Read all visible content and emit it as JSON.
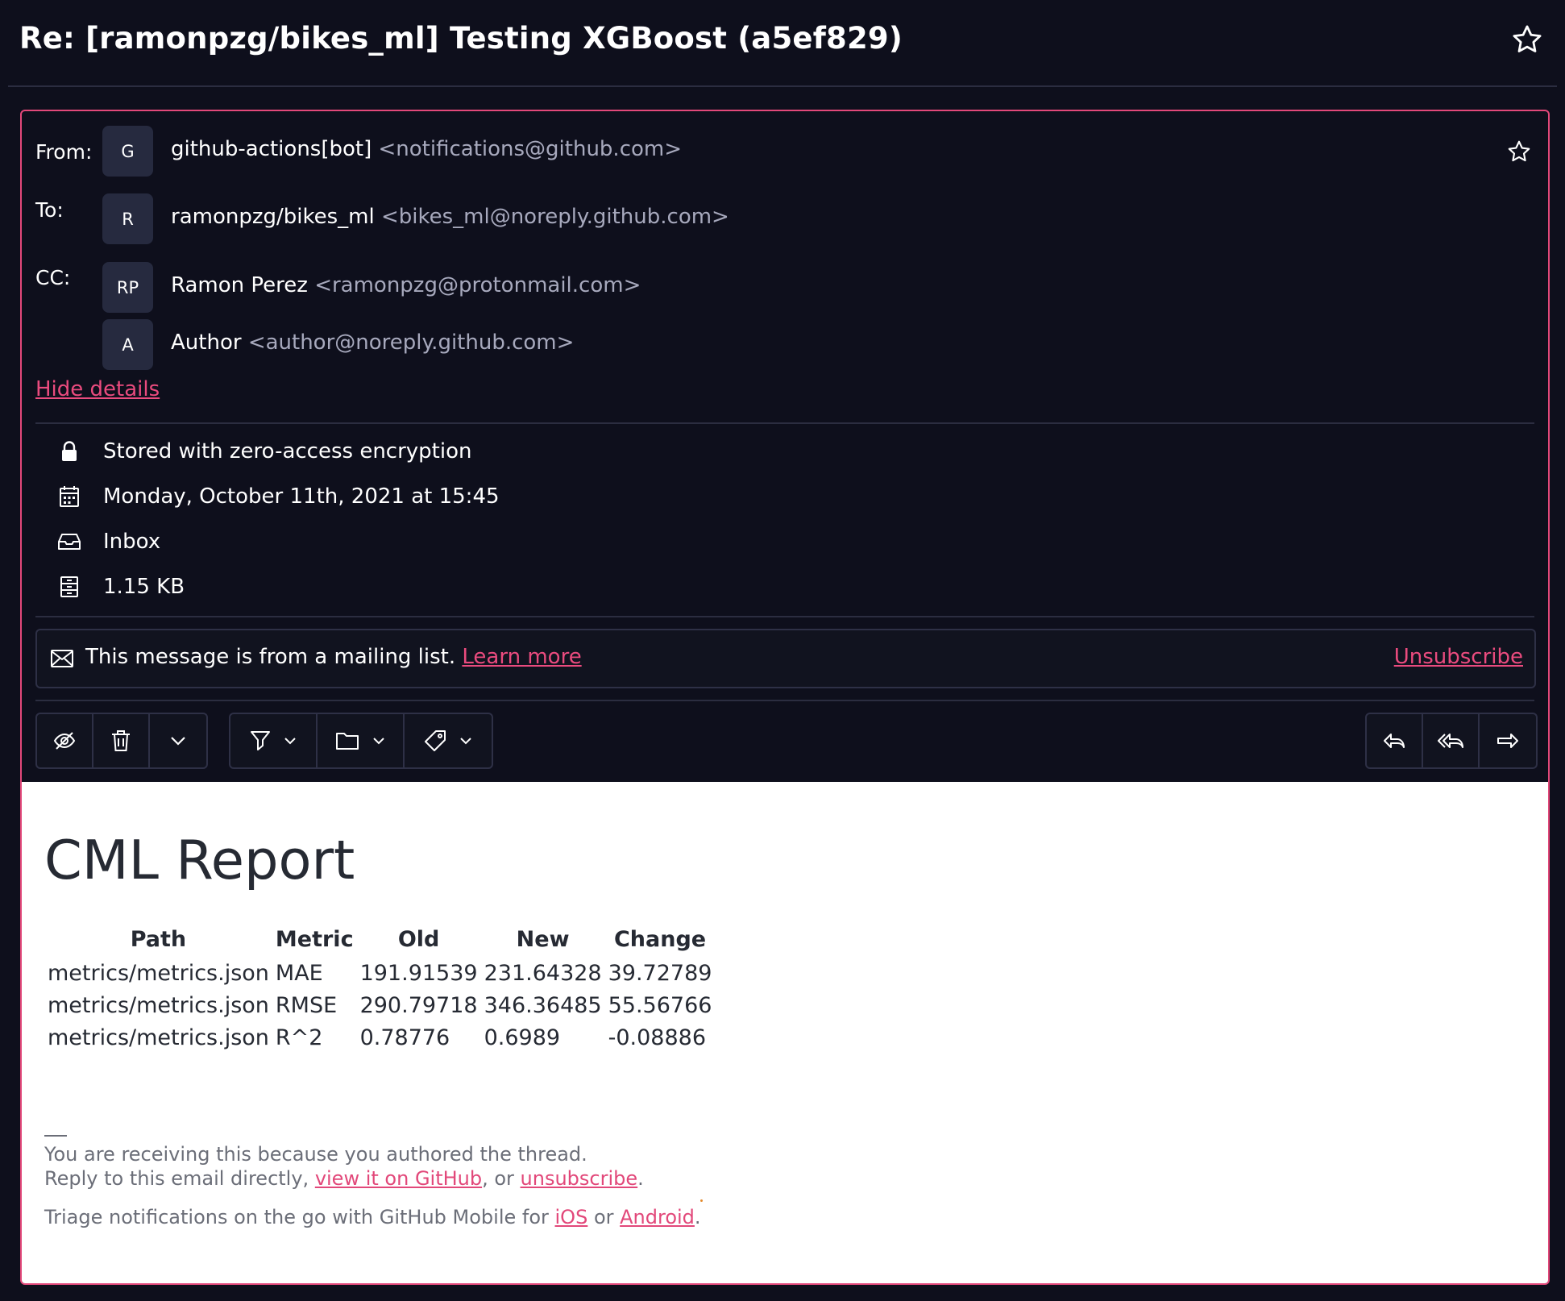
{
  "subject": "Re: [ramonpzg/bikes_ml] Testing XGBoost (a5ef829)",
  "header": {
    "from_label": "From:",
    "to_label": "To:",
    "cc_label": "CC:",
    "from": {
      "initials": "G",
      "name": "github-actions[bot]",
      "address": "<notifications@github.com>"
    },
    "to": {
      "initials": "R",
      "name": "ramonpzg/bikes_ml",
      "address": "<bikes_ml@noreply.github.com>"
    },
    "cc": [
      {
        "initials": "RP",
        "name": "Ramon Perez",
        "address": "<ramonpzg@protonmail.com>"
      },
      {
        "initials": "A",
        "name": "Author",
        "address": "<author@noreply.github.com>"
      }
    ],
    "hide_details": "Hide details"
  },
  "details": {
    "encryption": {
      "icon": "lock-icon",
      "text": "Stored with zero-access encryption"
    },
    "date": {
      "icon": "calendar-icon",
      "text": "Monday, October 11th, 2021 at 15:45"
    },
    "folder": {
      "icon": "inbox-icon",
      "text": "Inbox"
    },
    "size": {
      "icon": "file-size-icon",
      "text": "1.15 KB"
    }
  },
  "mailing_list": {
    "icon": "envelope-icon",
    "text": "This message is from a mailing list.",
    "learn_more": "Learn more",
    "unsubscribe": "Unsubscribe"
  },
  "toolbar": {
    "left": [
      "mark-unread-icon",
      "trash-icon",
      "chevron-down-icon"
    ],
    "middle": [
      "filter-icon",
      "folder-icon",
      "label-icon"
    ],
    "right": [
      "reply-icon",
      "reply-all-icon",
      "forward-icon"
    ]
  },
  "body": {
    "title": "CML Report",
    "table": {
      "headers": [
        "Path",
        "Metric",
        "Old",
        "New",
        "Change"
      ],
      "rows": [
        [
          "metrics/metrics.json",
          "MAE",
          "191.91539",
          "231.64328",
          "39.72789"
        ],
        [
          "metrics/metrics.json",
          "RMSE",
          "290.79718",
          "346.36485",
          "55.56766"
        ],
        [
          "metrics/metrics.json",
          "R^2",
          "0.78776",
          "0.6989",
          "-0.08886"
        ]
      ]
    },
    "footer": {
      "line1": "You are receiving this because you authored the thread.",
      "line2_prefix": "Reply to this email directly, ",
      "view_on_github": "view it on GitHub",
      "line2_mid": ", or ",
      "unsubscribe": "unsubscribe",
      "line2_end": ".",
      "line3_prefix": "Triage notifications on the go with GitHub Mobile for ",
      "ios": "iOS",
      "line3_mid": " or ",
      "android": "Android",
      "line3_end": "."
    }
  },
  "colors": {
    "accent": "#ea4b7e",
    "background": "#0e0f1c",
    "panel": "#262a3f"
  }
}
